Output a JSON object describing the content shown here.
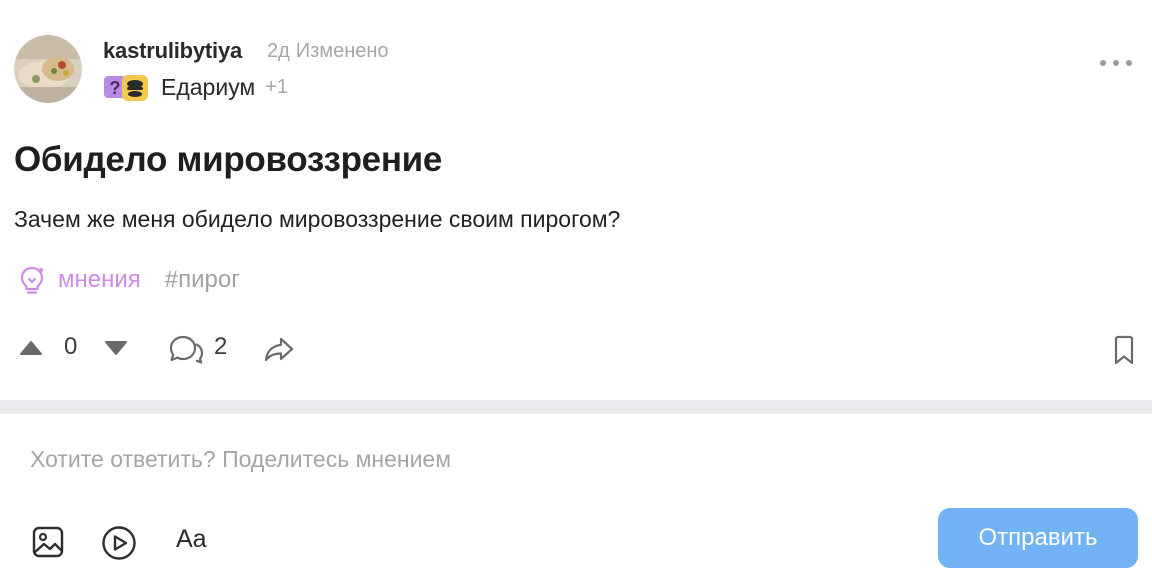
{
  "post": {
    "author": "kastrulibytiya",
    "age": "2д",
    "edited_label": "Изменено",
    "community": {
      "name": "Едариум",
      "extra": "+1",
      "icon_primary": "question-sticker-icon",
      "icon_secondary": "food-emoji-icon"
    },
    "title": "Обидело мировоззрение",
    "body": "Зачем же меня обидело мировоззрение своим пирогом?",
    "tags": {
      "community_tag": "мнения",
      "hashtag": "#пирог"
    },
    "stats": {
      "score": "0",
      "comments": "2"
    }
  },
  "composer": {
    "placeholder": "Хотите ответить? Поделитесь мнением",
    "format_label": "Aa",
    "send_label": "Отправить"
  },
  "icons": {
    "upvote": "arrow-up-icon",
    "downvote": "arrow-down-icon",
    "comments": "comments-icon",
    "share": "share-icon",
    "bookmark": "bookmark-icon",
    "more": "more-dots-icon",
    "image": "image-icon",
    "video": "play-icon",
    "bulb": "lightbulb-icon"
  },
  "colors": {
    "accent_pink": "#cf8ae8",
    "send_button": "#72b3f6",
    "muted_text": "#a7a7a7",
    "divider": "#ebebef"
  }
}
